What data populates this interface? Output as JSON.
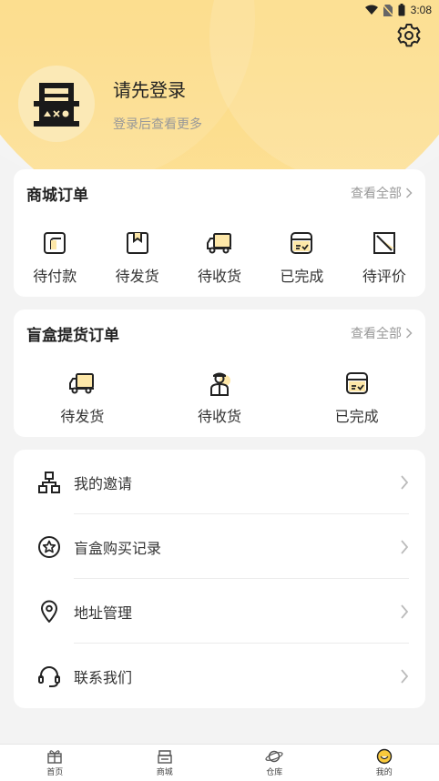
{
  "status_bar": {
    "time": "3:08"
  },
  "profile": {
    "title": "请先登录",
    "subtitle": "登录后查看更多"
  },
  "mall_orders": {
    "title": "商城订单",
    "view_all": "查看全部",
    "items": [
      {
        "label": "待付款",
        "icon": "wallet-icon"
      },
      {
        "label": "待发货",
        "icon": "package-icon"
      },
      {
        "label": "待收货",
        "icon": "truck-icon"
      },
      {
        "label": "已完成",
        "icon": "box-check-icon"
      },
      {
        "label": "待评价",
        "icon": "edit-icon"
      }
    ]
  },
  "blindbox_orders": {
    "title": "盲盒提货订单",
    "view_all": "查看全部",
    "items": [
      {
        "label": "待发货",
        "icon": "truck-icon"
      },
      {
        "label": "待收货",
        "icon": "courier-icon"
      },
      {
        "label": "已完成",
        "icon": "box-check-icon"
      }
    ]
  },
  "menu": [
    {
      "label": "我的邀请",
      "icon": "org-chart-icon"
    },
    {
      "label": "盲盒购买记录",
      "icon": "star-circle-icon"
    },
    {
      "label": "地址管理",
      "icon": "location-pin-icon"
    },
    {
      "label": "联系我们",
      "icon": "headset-icon"
    }
  ],
  "tabbar": [
    {
      "label": "首页",
      "icon": "gift-icon"
    },
    {
      "label": "商城",
      "icon": "shop-icon"
    },
    {
      "label": "仓库",
      "icon": "planet-icon"
    },
    {
      "label": "我的",
      "icon": "smile-icon"
    }
  ],
  "colors": {
    "header": "#fcd97f",
    "accent": "#f9c93c",
    "card": "#ffffff",
    "background": "#f3f3f3"
  }
}
